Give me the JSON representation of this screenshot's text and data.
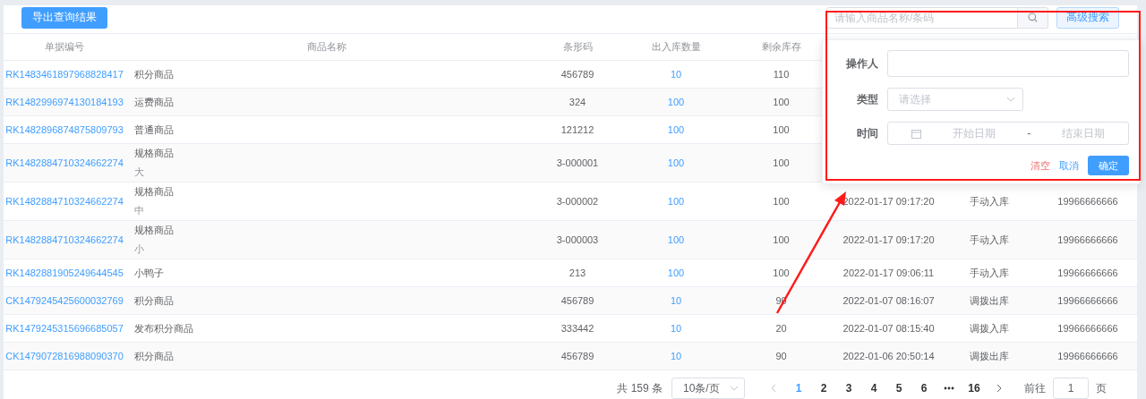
{
  "toolbar": {
    "export_button": "导出查询结果",
    "search": {
      "placeholder": "请输入商品名称/条码"
    },
    "advanced_button": "高级搜索"
  },
  "table": {
    "columns": [
      "单据编号",
      "商品名称",
      "条形码",
      "出入库数量",
      "剩余库存"
    ],
    "rows": [
      {
        "id": "RK1483461897968828417",
        "name": "积分商品",
        "barcode": "456789",
        "quantity": "10",
        "stock": "110"
      },
      {
        "id": "RK1482996974130184193",
        "name": "运费商品",
        "barcode": "324",
        "quantity": "100",
        "stock": "100"
      },
      {
        "id": "RK1482896874875809793",
        "name": "普通商品",
        "barcode": "121212",
        "quantity": "100",
        "stock": "100"
      },
      {
        "id": "RK1482884710324662274",
        "name": "规格商品",
        "spec": "大",
        "barcode": "3-000001",
        "quantity": "100",
        "stock": "100"
      },
      {
        "id": "RK1482884710324662274",
        "name": "规格商品",
        "spec": "中",
        "barcode": "3-000002",
        "quantity": "100",
        "stock": "100",
        "time": "2022-01-17 09:17:20",
        "type": "手动入库",
        "operator": "19966666666"
      },
      {
        "id": "RK1482884710324662274",
        "name": "规格商品",
        "spec": "小",
        "barcode": "3-000003",
        "quantity": "100",
        "stock": "100",
        "time": "2022-01-17 09:17:20",
        "type": "手动入库",
        "operator": "19966666666"
      },
      {
        "id": "RK1482881905249644545",
        "name": "小鸭子",
        "barcode": "213",
        "quantity": "100",
        "stock": "100",
        "time": "2022-01-17 09:06:11",
        "type": "手动入库",
        "operator": "19966666666"
      },
      {
        "id": "CK1479245425600032769",
        "name": "积分商品",
        "barcode": "456789",
        "quantity": "10",
        "stock": "90",
        "time": "2022-01-07 08:16:07",
        "type": "调拨出库",
        "operator": "19966666666"
      },
      {
        "id": "RK1479245315696685057",
        "name": "发布积分商品",
        "barcode": "333442",
        "quantity": "10",
        "stock": "20",
        "time": "2022-01-07 08:15:40",
        "type": "调拨入库",
        "operator": "19966666666"
      },
      {
        "id": "CK1479072816988090370",
        "name": "积分商品",
        "barcode": "456789",
        "quantity": "10",
        "stock": "90",
        "time": "2022-01-06 20:50:14",
        "type": "调拨出库",
        "operator": "19966666666"
      }
    ]
  },
  "popover": {
    "fields": [
      {
        "kind": "input",
        "label": "操作人"
      },
      {
        "kind": "select",
        "label": "类型",
        "placeholder": "请选择"
      },
      {
        "kind": "daterange",
        "label": "时间",
        "start_placeholder": "开始日期",
        "separator": "-",
        "end_placeholder": "结束日期"
      }
    ],
    "buttons": [
      {
        "kind": "danger",
        "label": "清空"
      },
      {
        "kind": "link",
        "label": "取消"
      },
      {
        "kind": "primary",
        "label": "确定"
      }
    ]
  },
  "pagination": {
    "total": "共 159 条",
    "page_size": "10条/页",
    "pages": [
      {
        "label": "1",
        "selected": true
      },
      {
        "label": "2",
        "selected": false
      },
      {
        "label": "3",
        "selected": false
      },
      {
        "label": "4",
        "selected": false
      },
      {
        "label": "5",
        "selected": false
      },
      {
        "label": "6",
        "selected": false
      },
      {
        "label": "16",
        "selected": false
      }
    ],
    "goto_label": "前往",
    "goto_value": "1",
    "goto_suffix": "页"
  }
}
